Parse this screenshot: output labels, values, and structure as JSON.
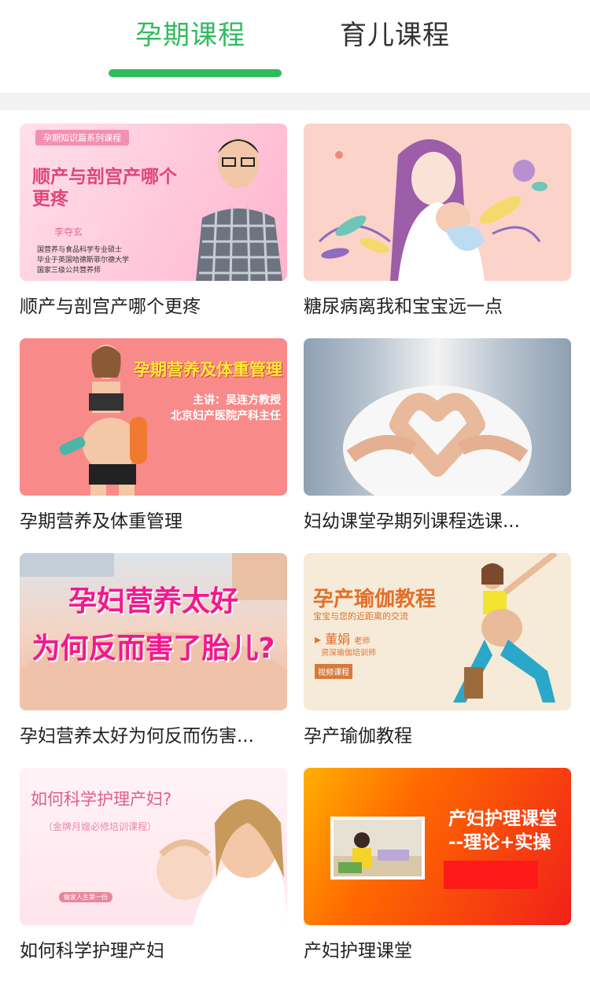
{
  "tabs": [
    {
      "label": "孕期课程",
      "active": true
    },
    {
      "label": "育儿课程",
      "active": false
    }
  ],
  "accent_color": "#2fbc5c",
  "cards": [
    {
      "title": "顺产与剖宫产哪个更疼",
      "thumb": {
        "tag": "孕期知识篇系列课程",
        "headline": "顺产与剖宫产哪个更疼",
        "name": "李夺玄",
        "bio": [
          "国营养与食品科学专业硕士",
          "毕业于英国哈德斯菲尔德大学",
          "国家三级公共营养师"
        ]
      }
    },
    {
      "title": "糖尿病离我和宝宝远一点",
      "thumb": {}
    },
    {
      "title": "孕期营养及体重管理",
      "thumb": {
        "headline": "孕期营养及体重管理",
        "line1": "主讲：吴连方教授",
        "line2": "北京妇产医院产科主任"
      }
    },
    {
      "title": "妇幼课堂孕期列课程选课...",
      "thumb": {}
    },
    {
      "title": "孕妇营养太好为何反而伤害...",
      "thumb": {
        "line1": "孕妇营养太好",
        "line2": "为何反而害了胎儿?"
      }
    },
    {
      "title": "孕产瑜伽教程",
      "thumb": {
        "headline": "孕产瑜伽教程",
        "sub": "宝宝与您的近距离的交流",
        "teacher": "董娟",
        "teacher_suffix": "老师",
        "teacher_role": "资深瑜伽培训师",
        "badge": "视频课程"
      }
    },
    {
      "title": "如何科学护理产妇",
      "thumb": {
        "headline": "如何科学护理产妇?",
        "sub": "（金牌月嫂必修培训课程）",
        "badge": "做家人生第一份"
      }
    },
    {
      "title": "产妇护理课堂",
      "thumb": {
        "line1": "产妇护理课堂",
        "line2": "--理论+实操"
      }
    }
  ]
}
